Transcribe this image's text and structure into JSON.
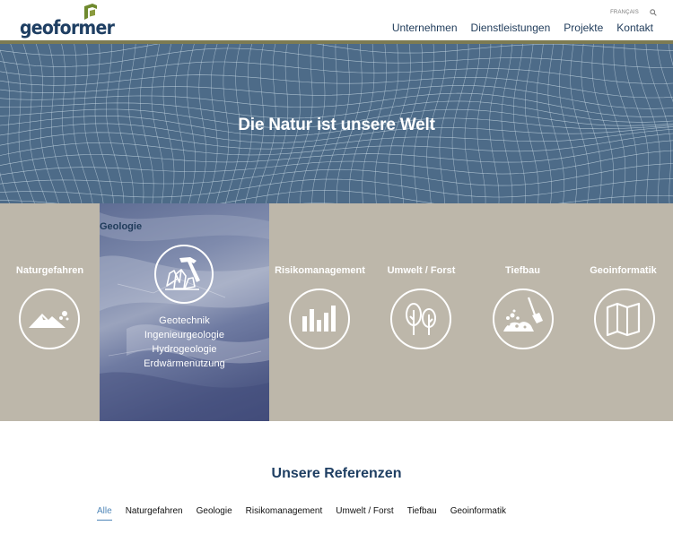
{
  "header": {
    "logo_text": "geoformer",
    "lang_link": "FRANÇAIS",
    "nav": [
      "Unternehmen",
      "Dienstleistungen",
      "Projekte",
      "Kontakt"
    ]
  },
  "hero": {
    "title": "Die Natur ist unsere Welt"
  },
  "services": {
    "active": {
      "label": "Geologie",
      "icon": "geology-crystal-hammer-icon",
      "sub_items": [
        "Geotechnik",
        "Ingenieurgeologie",
        "Hydrogeologie",
        "Erdwärmenutzung"
      ]
    },
    "items": [
      {
        "label": "Naturgefahren",
        "icon": "mountain-rockfall-icon"
      },
      {
        "label": "Risikomanagement",
        "icon": "bar-chart-icon"
      },
      {
        "label": "Umwelt / Forst",
        "icon": "trees-icon"
      },
      {
        "label": "Tiefbau",
        "icon": "shovel-dirt-icon"
      },
      {
        "label": "Geoinformatik",
        "icon": "folded-map-icon"
      }
    ]
  },
  "references": {
    "title": "Unsere Referenzen",
    "filters": [
      "Alle",
      "Naturgefahren",
      "Geologie",
      "Risikomanagement",
      "Umwelt / Forst",
      "Tiefbau",
      "Geoinformatik"
    ],
    "active_filter": "Alle"
  },
  "colors": {
    "brand_navy": "#1f3f63",
    "olive": "#7d7b52",
    "logo_green": "#6f8a2e",
    "hero_blue": "#4d6b88",
    "services_beige": "#bdb7aa",
    "filter_active": "#4f86b8"
  }
}
